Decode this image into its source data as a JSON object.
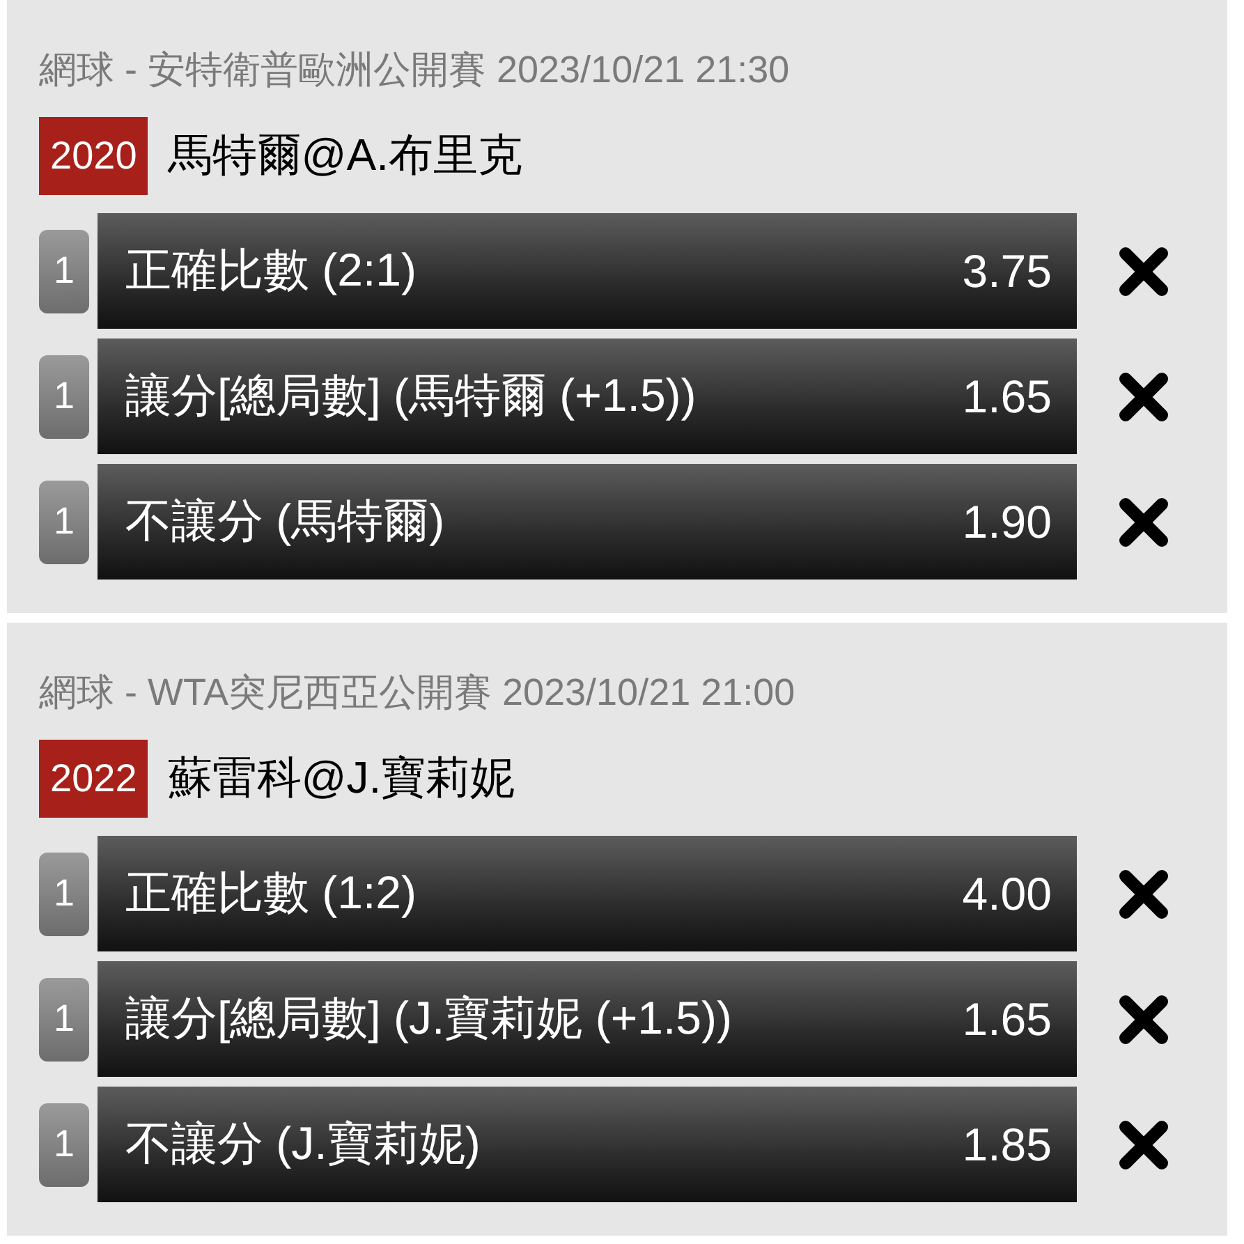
{
  "events": [
    {
      "header": "網球 - 安特衛普歐洲公開賽 2023/10/21 21:30",
      "code": "2020",
      "match": "馬特爾@A.布里克",
      "selections": [
        {
          "count": "1",
          "label": "正確比數 (2:1)",
          "odds": "3.75"
        },
        {
          "count": "1",
          "label": "讓分[總局數] (馬特爾 (+1.5))",
          "odds": "1.65"
        },
        {
          "count": "1",
          "label": "不讓分 (馬特爾)",
          "odds": "1.90"
        }
      ]
    },
    {
      "header": "網球 - WTA突尼西亞公開賽 2023/10/21 21:00",
      "code": "2022",
      "match": "蘇雷科@J.寶莉妮",
      "selections": [
        {
          "count": "1",
          "label": "正確比數 (1:2)",
          "odds": "4.00"
        },
        {
          "count": "1",
          "label": "讓分[總局數] (J.寶莉妮 (+1.5))",
          "odds": "1.65"
        },
        {
          "count": "1",
          "label": "不讓分 (J.寶莉妮)",
          "odds": "1.85"
        }
      ]
    }
  ]
}
